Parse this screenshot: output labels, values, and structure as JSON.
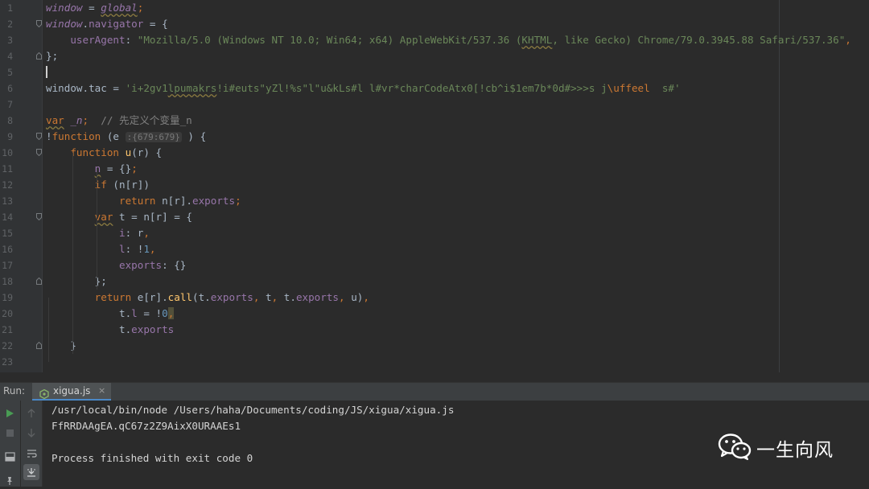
{
  "editor": {
    "lines": [
      {
        "n": "1",
        "fold": "none",
        "tokens": [
          {
            "t": "window",
            "c": "t-idi"
          },
          {
            "t": " = ",
            "c": "t-plain"
          },
          {
            "t": "global",
            "c": "t-idi t-und"
          },
          {
            "t": ";",
            "c": "t-kw"
          }
        ]
      },
      {
        "n": "2",
        "fold": "open",
        "tokens": [
          {
            "t": "window",
            "c": "t-idi"
          },
          {
            "t": ".",
            "c": "t-plain"
          },
          {
            "t": "navigator",
            "c": "t-id"
          },
          {
            "t": " = {",
            "c": "t-plain"
          }
        ]
      },
      {
        "n": "3",
        "fold": "none",
        "tokens": [
          {
            "t": "    userAgent",
            "c": "t-id"
          },
          {
            "t": ": ",
            "c": "t-plain"
          },
          {
            "t": "\"Mozilla/5.0 (Windows NT 10.0; Win64; x64) AppleWebKit/537.36 (",
            "c": "t-str"
          },
          {
            "t": "KHTML",
            "c": "t-str t-und"
          },
          {
            "t": ", like Gecko) Chrome/79.0.3945.88 Safari/537.36\"",
            "c": "t-str"
          },
          {
            "t": ",",
            "c": "t-kw"
          }
        ]
      },
      {
        "n": "4",
        "fold": "close",
        "tokens": [
          {
            "t": "};",
            "c": "t-plain"
          }
        ]
      },
      {
        "n": "5",
        "fold": "none",
        "tokens": []
      },
      {
        "n": "6",
        "fold": "none",
        "tokens": [
          {
            "t": "window",
            "c": "t-plain"
          },
          {
            "t": ".",
            "c": "t-plain"
          },
          {
            "t": "tac",
            "c": "t-plain"
          },
          {
            "t": " = ",
            "c": "t-plain"
          },
          {
            "t": "'i+2gv1",
            "c": "t-str"
          },
          {
            "t": "lpumakrs",
            "c": "t-str t-und"
          },
          {
            "t": "!i#euts\"yZl!%s\"l\"u&kLs#l l#vr*charCodeAtx0[!cb^i$1em7b*0d#>>>s j",
            "c": "t-str"
          },
          {
            "t": "\\uffeel",
            "c": "t-kw"
          },
          {
            "t": "  s#'",
            "c": "t-str"
          }
        ]
      },
      {
        "n": "7",
        "fold": "none",
        "tokens": []
      },
      {
        "n": "8",
        "fold": "none",
        "tokens": [
          {
            "t": "var",
            "c": "t-kw t-und"
          },
          {
            "t": " ",
            "c": "t-plain"
          },
          {
            "t": "_n",
            "c": "t-idi"
          },
          {
            "t": ";",
            "c": "t-kw"
          },
          {
            "t": "  // 先定义个变量_n",
            "c": "t-cm"
          }
        ]
      },
      {
        "n": "9",
        "fold": "open",
        "tokens": [
          {
            "t": "!",
            "c": "t-plain"
          },
          {
            "t": "function",
            "c": "t-kw"
          },
          {
            "t": " (e ",
            "c": "t-plain"
          },
          {
            "t": ":{679:679}",
            "c": "t-hint"
          },
          {
            "t": " ) {",
            "c": "t-plain"
          }
        ]
      },
      {
        "n": "10",
        "fold": "open",
        "tokens": [
          {
            "t": "    function",
            "c": "t-kw"
          },
          {
            "t": " ",
            "c": "t-plain"
          },
          {
            "t": "u",
            "c": "t-fn"
          },
          {
            "t": "(r) {",
            "c": "t-plain"
          }
        ]
      },
      {
        "n": "11",
        "fold": "none",
        "tokens": [
          {
            "t": "        ",
            "c": "t-plain"
          },
          {
            "t": "n",
            "c": "t-id t-und"
          },
          {
            "t": " = {}",
            "c": "t-plain"
          },
          {
            "t": ";",
            "c": "t-kw"
          }
        ]
      },
      {
        "n": "12",
        "fold": "none",
        "tokens": [
          {
            "t": "        if",
            "c": "t-kw"
          },
          {
            "t": " (n[r])",
            "c": "t-plain"
          }
        ]
      },
      {
        "n": "13",
        "fold": "none",
        "tokens": [
          {
            "t": "            return",
            "c": "t-kw"
          },
          {
            "t": " n[r].",
            "c": "t-plain"
          },
          {
            "t": "exports",
            "c": "t-id"
          },
          {
            "t": ";",
            "c": "t-kw"
          }
        ]
      },
      {
        "n": "14",
        "fold": "open",
        "tokens": [
          {
            "t": "        ",
            "c": "t-plain"
          },
          {
            "t": "var",
            "c": "t-kw t-und"
          },
          {
            "t": " t = n[r] = {",
            "c": "t-plain"
          }
        ]
      },
      {
        "n": "15",
        "fold": "none",
        "tokens": [
          {
            "t": "            i",
            "c": "t-id"
          },
          {
            "t": ": r",
            "c": "t-plain"
          },
          {
            "t": ",",
            "c": "t-kw"
          }
        ]
      },
      {
        "n": "16",
        "fold": "none",
        "tokens": [
          {
            "t": "            l",
            "c": "t-id"
          },
          {
            "t": ": !",
            "c": "t-plain"
          },
          {
            "t": "1",
            "c": "t-num"
          },
          {
            "t": ",",
            "c": "t-kw"
          }
        ]
      },
      {
        "n": "17",
        "fold": "none",
        "tokens": [
          {
            "t": "            exports",
            "c": "t-id"
          },
          {
            "t": ": {}",
            "c": "t-plain"
          }
        ]
      },
      {
        "n": "18",
        "fold": "close",
        "tokens": [
          {
            "t": "        };",
            "c": "t-plain"
          }
        ]
      },
      {
        "n": "19",
        "fold": "none",
        "tokens": [
          {
            "t": "        return",
            "c": "t-kw"
          },
          {
            "t": " e[r].",
            "c": "t-plain"
          },
          {
            "t": "call",
            "c": "t-fn"
          },
          {
            "t": "(t.",
            "c": "t-plain"
          },
          {
            "t": "exports",
            "c": "t-id"
          },
          {
            "t": ",",
            "c": "t-kw"
          },
          {
            "t": " t",
            "c": "t-plain"
          },
          {
            "t": ",",
            "c": "t-kw"
          },
          {
            "t": " t.",
            "c": "t-plain"
          },
          {
            "t": "exports",
            "c": "t-id"
          },
          {
            "t": ",",
            "c": "t-kw"
          },
          {
            "t": " u)",
            "c": "t-plain"
          },
          {
            "t": ",",
            "c": "t-kw"
          }
        ]
      },
      {
        "n": "20",
        "fold": "none",
        "tokens": [
          {
            "t": "            t.",
            "c": "t-plain"
          },
          {
            "t": "l",
            "c": "t-id"
          },
          {
            "t": " = !",
            "c": "t-plain"
          },
          {
            "t": "0",
            "c": "t-num"
          },
          {
            "t": ",",
            "c": "t-kw t-hl"
          }
        ]
      },
      {
        "n": "21",
        "fold": "none",
        "tokens": [
          {
            "t": "            t.",
            "c": "t-plain"
          },
          {
            "t": "exports",
            "c": "t-id"
          }
        ]
      },
      {
        "n": "22",
        "fold": "close",
        "tokens": [
          {
            "t": "    }",
            "c": "t-plain"
          }
        ]
      },
      {
        "n": "23",
        "fold": "none",
        "tokens": []
      }
    ]
  },
  "run_panel": {
    "label": "Run:",
    "tab_title": "xigua.js",
    "tab_close": "×",
    "console_lines": [
      "/usr/local/bin/node /Users/haha/Documents/coding/JS/xigua/xigua.js",
      "FfRRDAAgEA.qC67z2Z9AixX0URAAEs1",
      "",
      "Process finished with exit code 0"
    ]
  },
  "watermark": {
    "icon": "wechat-icon",
    "text": "一生向风"
  },
  "colors": {
    "background": "#2b2b2b",
    "keyword": "#cc7832",
    "string": "#6a8759",
    "identifier": "#9876aa",
    "function": "#ffc66d",
    "comment": "#808080",
    "number": "#6897bb",
    "run_green": "#499c54"
  }
}
